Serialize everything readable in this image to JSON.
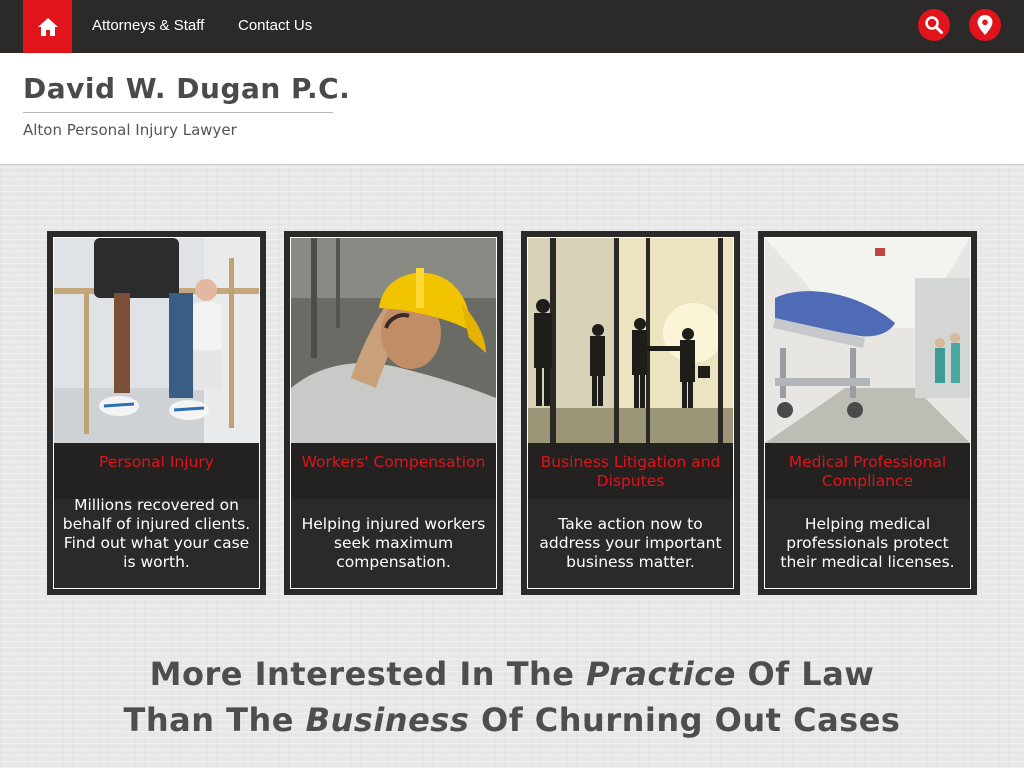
{
  "nav": {
    "links": [
      {
        "label": "Attorneys & Staff"
      },
      {
        "label": "Contact Us"
      }
    ],
    "icons": {
      "home": "home-icon",
      "search": "search-icon",
      "location": "map-pin-icon"
    },
    "accent_color": "#e1131b",
    "bar_color": "#2b2a29"
  },
  "header": {
    "firm_name": "David W. Dugan P.C.",
    "tagline": "Alton Personal Injury Lawyer"
  },
  "cards": [
    {
      "title": "Personal Injury",
      "description": "Millions recovered on behalf of injured clients. Find out what your case is worth.",
      "image": "physical-therapy-photo"
    },
    {
      "title": "Workers' Compensation",
      "description": "Helping injured workers seek maximum compensation.",
      "image": "injured-worker-photo"
    },
    {
      "title": "Business Litigation and Disputes",
      "description": "Take action now to address your important business matter.",
      "image": "business-handshake-photo"
    },
    {
      "title": "Medical Professional Compliance",
      "description": "Helping medical professionals protect their medical licenses.",
      "image": "hospital-corridor-photo"
    }
  ],
  "slogan": {
    "line1_before": "More Interested In The ",
    "line1_em": "Practice",
    "line1_after": " Of Law",
    "line2_before": "Than The ",
    "line2_em": "Business",
    "line2_after": " Of Churning Out Cases"
  }
}
